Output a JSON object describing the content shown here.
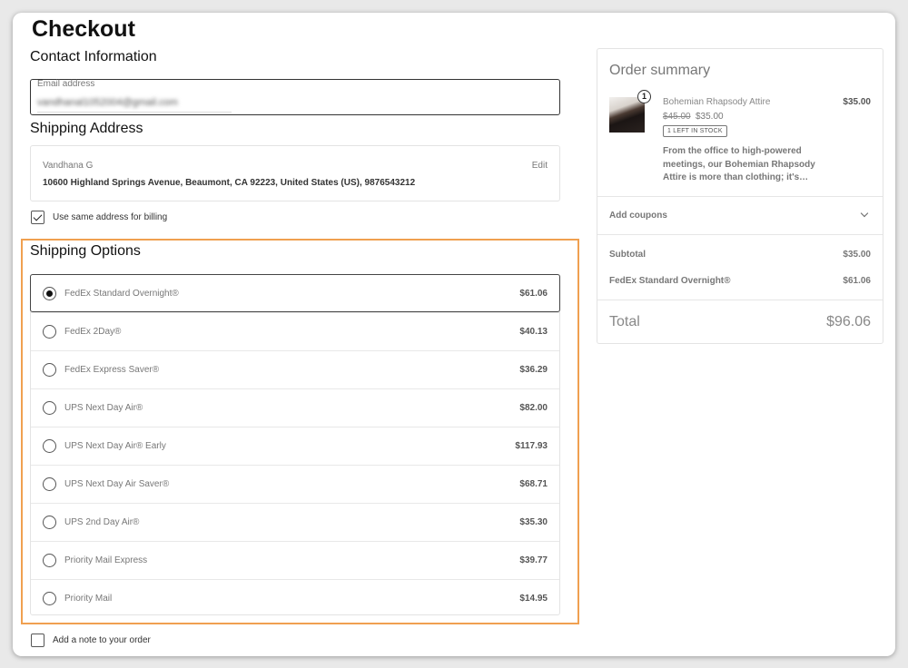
{
  "page": {
    "title": "Checkout"
  },
  "contact": {
    "title": "Contact Information",
    "email_label": "Email address",
    "email_value": "vandhanal1052004@gmail.com"
  },
  "shipping_address": {
    "title": "Shipping Address",
    "name": "Vandhana G",
    "address": "10600 Highland Springs Avenue, Beaumont, CA 92223, United States (US), 9876543212",
    "edit_label": "Edit"
  },
  "billing": {
    "same_address_label": "Use same address for billing",
    "checked": true
  },
  "shipping_options": {
    "title": "Shipping Options",
    "options": [
      {
        "label": "FedEx Standard Overnight®",
        "price": "$61.06",
        "selected": true
      },
      {
        "label": "FedEx 2Day®",
        "price": "$40.13",
        "selected": false
      },
      {
        "label": "FedEx Express Saver®",
        "price": "$36.29",
        "selected": false
      },
      {
        "label": "UPS Next Day Air®",
        "price": "$82.00",
        "selected": false
      },
      {
        "label": "UPS Next Day Air® Early",
        "price": "$117.93",
        "selected": false
      },
      {
        "label": "UPS Next Day Air Saver®",
        "price": "$68.71",
        "selected": false
      },
      {
        "label": "UPS 2nd Day Air®",
        "price": "$35.30",
        "selected": false
      },
      {
        "label": "Priority Mail Express",
        "price": "$39.77",
        "selected": false
      },
      {
        "label": "Priority Mail",
        "price": "$14.95",
        "selected": false
      }
    ]
  },
  "order_note": {
    "label": "Add a note to your order",
    "checked": false
  },
  "summary": {
    "title": "Order summary",
    "product": {
      "quantity": "1",
      "name": "Bohemian Rhapsody Attire",
      "price": "$35.00",
      "old_price": "$45.00",
      "new_price": "$35.00",
      "stock": "1 LEFT IN STOCK",
      "description": "From the office to high-powered meetings, our Bohemian Rhapsody Attire is more than clothing; it's…"
    },
    "coupons_label": "Add coupons",
    "subtotal_label": "Subtotal",
    "subtotal_value": "$35.00",
    "shipping_label": "FedEx Standard Overnight®",
    "shipping_value": "$61.06",
    "total_label": "Total",
    "total_value": "$96.06"
  },
  "colors": {
    "highlight_border": "#f0a050"
  }
}
